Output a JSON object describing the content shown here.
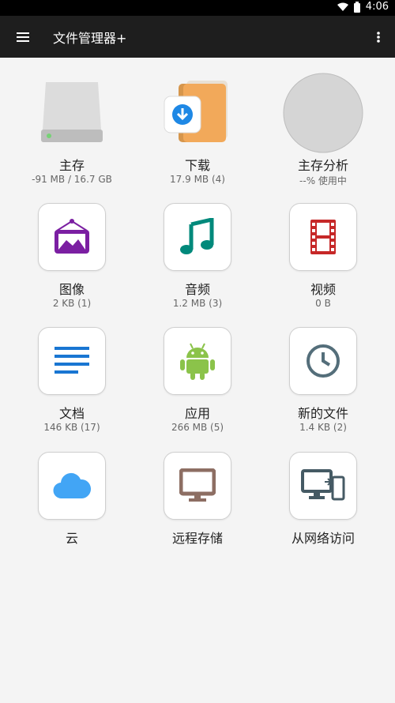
{
  "status_bar": {
    "time": "4:06"
  },
  "toolbar": {
    "title": "文件管理器+"
  },
  "grid": [
    {
      "label": "主存",
      "sub": "-91 MB / 16.7 GB",
      "icon": "hard-drive-icon"
    },
    {
      "label": "下载",
      "sub": "17.9 MB (4)",
      "icon": "download-folder-icon"
    },
    {
      "label": "主存分析",
      "sub": "--% 使用中",
      "icon": "storage-analysis-icon"
    },
    {
      "label": "图像",
      "sub": "2 KB (1)",
      "icon": "image-icon"
    },
    {
      "label": "音频",
      "sub": "1.2 MB (3)",
      "icon": "music-note-icon"
    },
    {
      "label": "视频",
      "sub": "0 B",
      "icon": "film-icon"
    },
    {
      "label": "文档",
      "sub": "146 KB (17)",
      "icon": "document-icon"
    },
    {
      "label": "应用",
      "sub": "266 MB (5)",
      "icon": "android-icon"
    },
    {
      "label": "新的文件",
      "sub": "1.4 KB (2)",
      "icon": "clock-icon"
    },
    {
      "label": "云",
      "sub": "",
      "icon": "cloud-icon"
    },
    {
      "label": "远程存储",
      "sub": "",
      "icon": "monitor-icon"
    },
    {
      "label": "从网络访问",
      "sub": "",
      "icon": "devices-icon"
    }
  ],
  "colors": {
    "toolbar": "#1e1e1e",
    "background": "#f4f4f4",
    "image_purple": "#7b1fa2",
    "music_teal": "#00897b",
    "film_red": "#c62828",
    "doc_blue": "#1976d2",
    "android_green": "#8bc34a",
    "clock_gray": "#546e7a",
    "cloud_blue": "#42a5f5",
    "monitor_brown": "#8d6e63",
    "devices_green": "#455a64"
  }
}
